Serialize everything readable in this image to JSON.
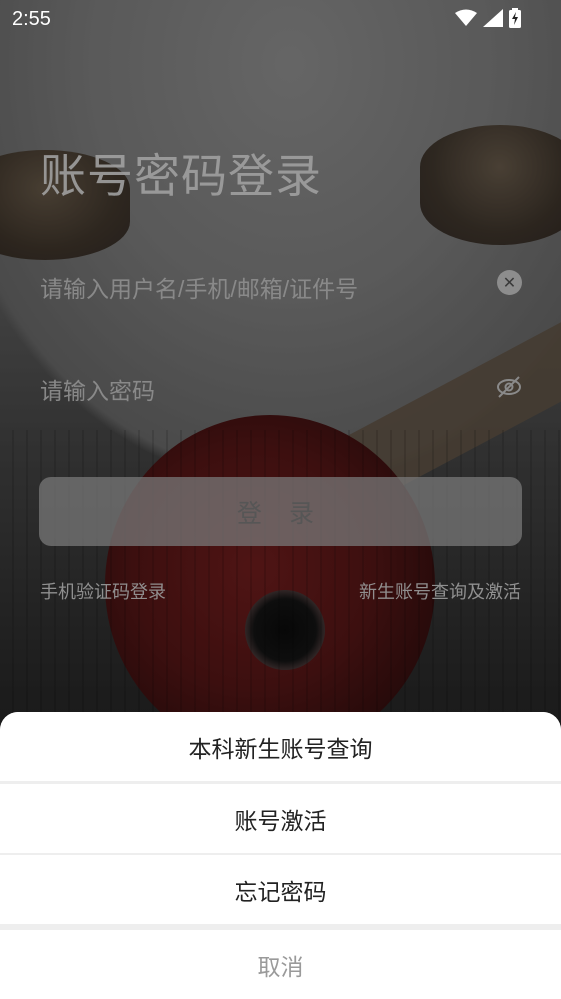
{
  "status_bar": {
    "time": "2:55",
    "icons": [
      "wifi-icon",
      "signal-icon",
      "battery-charging-icon"
    ]
  },
  "login": {
    "title": "账号密码登录",
    "username_placeholder": "请输入用户名/手机/邮箱/证件号",
    "password_placeholder": "请输入密码",
    "login_button": "登 录",
    "sms_login_link": "手机验证码登录",
    "activate_link": "新生账号查询及激活"
  },
  "sheet": {
    "items": [
      "本科新生账号查询",
      "账号激活",
      "忘记密码"
    ],
    "cancel": "取消"
  },
  "colors": {
    "sheet_background": "#ffffff",
    "sheet_divider": "#eeeeee",
    "cancel_text": "#9a9a9a"
  }
}
